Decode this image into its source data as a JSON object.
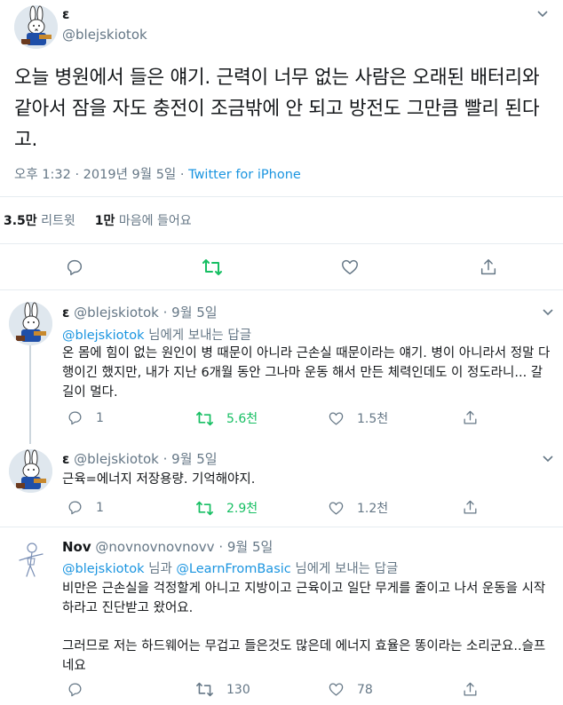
{
  "main_tweet": {
    "name": "ε",
    "handle": "@blejskiotok",
    "text": "오늘 병원에서 들은 얘기. 근력이 너무 없는 사람은 오래된 배터리와 같아서 잠을 자도 충전이 조금밖에 안 되고 방전도 그만큼 빨리 된다고.",
    "timestamp": "오후 1:32 · 2019년 9월 5일 · ",
    "via": "Twitter for iPhone",
    "retweets_count": "3.5만",
    "retweets_label": "리트윗",
    "likes_count": "1만",
    "likes_label": "마음에 들어요"
  },
  "replies": [
    {
      "name": "ε",
      "handle": "@blejskiotok",
      "date": "· 9월 5일",
      "reply_to_mention": "@blejskiotok",
      "reply_to_suffix": " 님에게 보내는 답글",
      "text": "온 몸에 힘이 없는 원인이 병 때문이 아니라 근손실 때문이라는 얘기. 병이 아니라서 정말 다행이긴 했지만, 내가 지난 6개월 동안 그나마 운동 해서 만든 체력인데도 이 정도라니... 갈 길이 멀다.",
      "reply_count": "1",
      "retweet_count": "5.6천",
      "like_count": "1.5천"
    },
    {
      "name": "ε",
      "handle": "@blejskiotok",
      "date": "· 9월 5일",
      "text": "근육=에너지 저장용량. 기억해야지.",
      "reply_count": "1",
      "retweet_count": "2.9천",
      "like_count": "1.2천"
    },
    {
      "name": "Nov",
      "handle": "@novnovnovnovv",
      "date": "· 9월 5일",
      "reply_to_mention_1": "@blejskiotok",
      "reply_to_mid": " 님과 ",
      "reply_to_mention_2": "@LearnFromBasic",
      "reply_to_suffix": " 님에게 보내는 답글",
      "text_1": "비만은 근손실을 걱정할게 아니고 지방이고 근육이고 일단 무게를 줄이고 나서 운동을 시작하라고 진단받고 왔어요.",
      "text_2": "그러므로 저는 하드웨어는 무겁고 들은것도 많은데 에너지 효율은 똥이라는 소리군요..슬프네요",
      "retweet_count": "130",
      "like_count": "78"
    }
  ],
  "colors": {
    "text": "#14171a",
    "secondary": "#657786",
    "link": "#1b95e0",
    "retweet_active": "#17bf63",
    "border": "#e6ecf0"
  },
  "icons": {
    "reply": "reply-icon",
    "retweet": "retweet-icon",
    "like": "heart-icon",
    "share": "share-icon",
    "caret": "chevron-down-icon"
  }
}
